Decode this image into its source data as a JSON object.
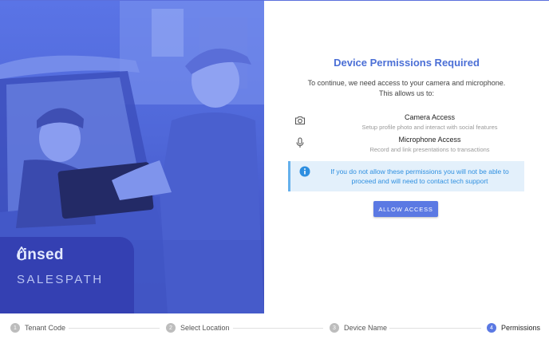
{
  "brand": {
    "logo_text": "rinsed",
    "product": "SALESPATH",
    "logo_icon": "water-drop-icon"
  },
  "permissions_page": {
    "title": "Device Permissions Required",
    "subtitle_line1": "To continue, we need access to your camera and microphone.",
    "subtitle_line2": "This allows us to:",
    "items": [
      {
        "icon": "camera-icon",
        "name": "Camera Access",
        "description": "Setup profile photo and interact with social features"
      },
      {
        "icon": "microphone-icon",
        "name": "Microphone Access",
        "description": "Record and link presentations to transactions"
      }
    ],
    "notice": {
      "icon": "info-icon",
      "line1": "If you do not allow these permissions you will not be able to",
      "line2": "proceed and will need to contact tech support"
    },
    "allow_button": "ALLOW ACCESS"
  },
  "stepper": {
    "steps": [
      {
        "number": "1",
        "label": "Tenant Code"
      },
      {
        "number": "2",
        "label": "Select Location"
      },
      {
        "number": "3",
        "label": "Device Name"
      },
      {
        "number": "4",
        "label": "Permissions"
      }
    ],
    "active_step": "4"
  },
  "colors": {
    "accent": "#5b79e3",
    "title": "#4b6fd6",
    "notice_bg": "#e3f0fb",
    "notice_text": "#2e8fe0",
    "hero_overlay": "#4f67d8",
    "brand_box": "#3440b2"
  }
}
